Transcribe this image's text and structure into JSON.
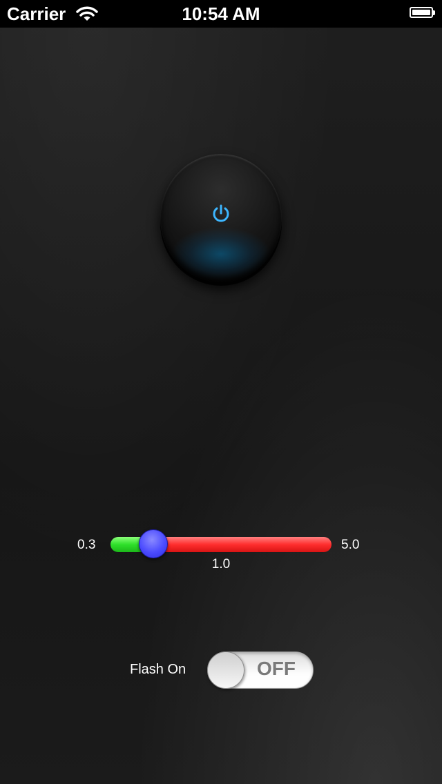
{
  "status_bar": {
    "carrier": "Carrier",
    "time": "10:54 AM",
    "wifi_icon": "wifi-icon",
    "battery_icon": "battery-icon",
    "battery_level": 1.0
  },
  "power_button": {
    "icon": "power-icon",
    "glow_color": "#2fa8e8"
  },
  "slider": {
    "min_label": "0.3",
    "max_label": "5.0",
    "value_label": "1.0",
    "min": 0.3,
    "max": 5.0,
    "value": 1.0,
    "min_track_color": "#2fe02a",
    "max_track_color": "#ff2e2e",
    "thumb_color": "#4b4bff"
  },
  "flash": {
    "label": "Flash On",
    "state_text": "OFF",
    "on": false
  }
}
